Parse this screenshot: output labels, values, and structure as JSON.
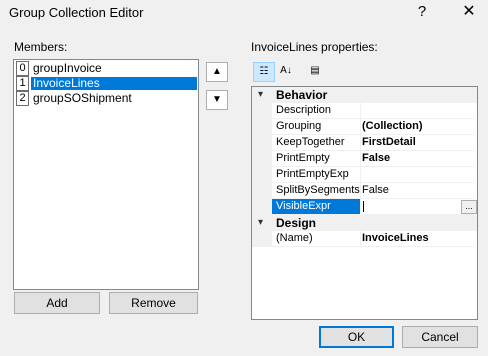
{
  "window": {
    "title": "Group Collection Editor",
    "help_glyph": "?",
    "close_glyph": "✕"
  },
  "members": {
    "label": "Members:",
    "items": [
      {
        "index": "0",
        "name": "groupInvoice",
        "selected": false
      },
      {
        "index": "1",
        "name": "InvoiceLines",
        "selected": true
      },
      {
        "index": "2",
        "name": "groupSOShipment",
        "selected": false
      }
    ]
  },
  "move_up_glyph": "▲",
  "move_down_glyph": "▼",
  "buttons": {
    "add": "Add",
    "remove": "Remove",
    "ok": "OK",
    "cancel": "Cancel"
  },
  "properties": {
    "label": "InvoiceLines properties:",
    "categorized_glyph": "☷",
    "alphabetical_glyph": "A↓",
    "pages_glyph": "▤",
    "collapse_glyph": "▾",
    "categories": [
      {
        "name": "Behavior",
        "rows": [
          {
            "name": "Description",
            "value": "",
            "bold": false
          },
          {
            "name": "Grouping",
            "value": "(Collection)",
            "bold": true
          },
          {
            "name": "KeepTogether",
            "value": "FirstDetail",
            "bold": true
          },
          {
            "name": "PrintEmpty",
            "value": "False",
            "bold": true
          },
          {
            "name": "PrintEmptyExp",
            "value": "",
            "bold": false
          },
          {
            "name": "SplitBySegments",
            "value": "False",
            "bold": false
          },
          {
            "name": "VisibleExpr",
            "value": "",
            "bold": false,
            "selected": true,
            "ellipsis": "..."
          }
        ]
      },
      {
        "name": "Design",
        "rows": [
          {
            "name": "(Name)",
            "value": "InvoiceLines",
            "bold": true
          }
        ]
      }
    ]
  }
}
